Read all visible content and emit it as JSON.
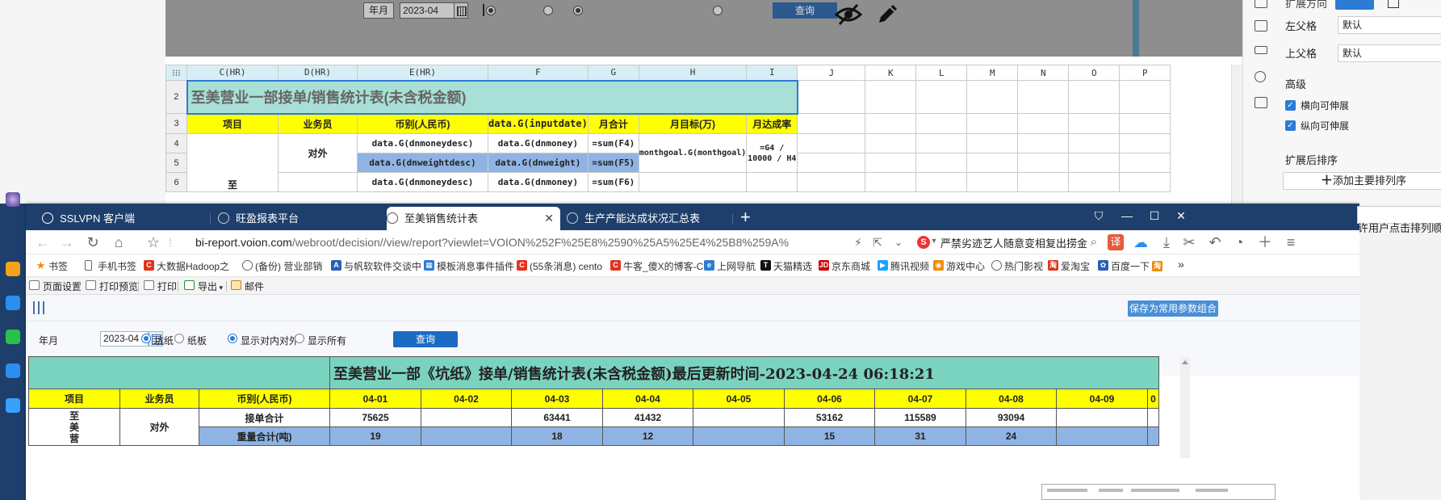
{
  "designer": {
    "param": {
      "year_month_label": "年月",
      "date_value": "2023-04",
      "query_label": "查询"
    },
    "col_headers": [
      "C(HR)",
      "D(HR)",
      "E(HR)",
      "F",
      "G",
      "H",
      "I",
      "J",
      "K",
      "L",
      "M",
      "N",
      "O",
      "P"
    ],
    "row_numbers": [
      "2",
      "3",
      "4",
      "5",
      "6"
    ],
    "title": "至美营业一部接单/销售统计表(未含税金额)",
    "headers": [
      "项目",
      "业务员",
      "币别(人民币)",
      "data.G(inputdate)",
      "月合计",
      "月目标(万)",
      "月达成率"
    ],
    "row4": {
      "salesman": "对外",
      "e": "data.G(dnmoneydesc)",
      "f": "data.G(dnmoney)",
      "g": "=sum(F4)",
      "h": "monthgoal.G(monthgoal)",
      "i": "=G4 / 10000 / H4"
    },
    "row5": {
      "e": "data.G(dnweightdesc)",
      "f": "data.G(dnweight)",
      "g": "=sum(F5)"
    },
    "row6": {
      "item": "至",
      "e": "data.G(dnmoneydesc)",
      "f": "data.G(dnmoney)",
      "g": "=sum(F6)"
    },
    "panel": {
      "extend_dir": "扩展方向",
      "left_parent_label": "左父格",
      "left_parent_value": "默认",
      "top_parent_label": "上父格",
      "top_parent_value": "默认",
      "advanced": "高级",
      "h_expand": "横向可伸展",
      "v_expand": "纵向可伸展",
      "sort_after": "扩展后排序",
      "add_sort": "添加主要排列序",
      "user_sort": "许用户点击排列顺序"
    }
  },
  "browser": {
    "tabs": [
      {
        "label": "SSLVPN 客户端"
      },
      {
        "label": "旺盈报表平台"
      },
      {
        "label": "至美销售统计表",
        "active": true
      },
      {
        "label": "生产产能达成状况汇总表"
      }
    ],
    "url_host": "bi-report.voion.com",
    "url_path": "/webroot/decision//view/report?viewlet=VOION%252F%25E8%2590%25A5%25E4%25B8%259A%",
    "search_hint": "严禁劣迹艺人随意变相复出捞金",
    "bookmarks": [
      {
        "label": "书签",
        "color": "#f08c00",
        "icon": "star-icon"
      },
      {
        "label": "手机书签",
        "color": "#666666",
        "icon": "phone-icon"
      },
      {
        "label": "大数据Hadoop之",
        "color": "#e0341f",
        "icon": "c-icon"
      },
      {
        "label": "(备份) 营业部销",
        "color": "#666666",
        "icon": "globe-icon"
      },
      {
        "label": "与帆软软件交谈中",
        "color": "#2b5fb4",
        "icon": "fanruan-icon"
      },
      {
        "label": "模板消息事件插件",
        "color": "#2b7cd3",
        "icon": "grid-icon"
      },
      {
        "label": "(55条消息) cento",
        "color": "#e0341f",
        "icon": "c-icon"
      },
      {
        "label": "牛客_傻X的博客-C",
        "color": "#e0341f",
        "icon": "c-icon"
      },
      {
        "label": "上网导航",
        "color": "#2b7cd3",
        "icon": "e-icon"
      },
      {
        "label": "天猫精选",
        "color": "#c00",
        "icon": "tmall-icon"
      },
      {
        "label": "京东商城",
        "color": "#c00",
        "icon": "jd-icon"
      },
      {
        "label": "腾讯视频",
        "color": "#19a3ff",
        "icon": "play-icon"
      },
      {
        "label": "游戏中心",
        "color": "#f08c00",
        "icon": "gamepad-icon"
      },
      {
        "label": "热门影视",
        "color": "#666666",
        "icon": "globe-icon"
      },
      {
        "label": "爱淘宝",
        "color": "#e0341f",
        "icon": "taobao-icon"
      },
      {
        "label": "百度一下",
        "color": "#2b5fb4",
        "icon": "baidu-icon"
      }
    ],
    "toolbar": {
      "page_setup": "页面设置",
      "print_preview": "打印预览",
      "print": "打印",
      "export": "导出",
      "mail": "邮件"
    },
    "param": {
      "save_params": "保存为常用参数组合",
      "year_month_label": "年月",
      "date_value": "2023-04",
      "radio_paper_a": "坑纸",
      "radio_paper_b": "纸板",
      "radio_show_internal": "显示对内对外",
      "radio_show_all": "显示所有",
      "query": "查询"
    },
    "report": {
      "title": "至美营业一部《坑纸》接单/销售统计表(未含税金额)最后更新时间-2023-04-24 06:18:21",
      "headers": [
        "项目",
        "业务员",
        "币别(人民币)",
        "04-01",
        "04-02",
        "04-03",
        "04-04",
        "04-05",
        "04-06",
        "04-07",
        "04-08",
        "04-09",
        "0"
      ],
      "item_label": "至美营",
      "salesman": "对外",
      "row1_label": "接单合计",
      "row1_values": [
        "75625",
        "",
        "63441",
        "41432",
        "",
        "53162",
        "115589",
        "93094",
        "",
        ""
      ],
      "row2_label": "重量合计(吨)",
      "row2_values": [
        "19",
        "",
        "18",
        "12",
        "",
        "15",
        "31",
        "24",
        "",
        ""
      ]
    }
  }
}
